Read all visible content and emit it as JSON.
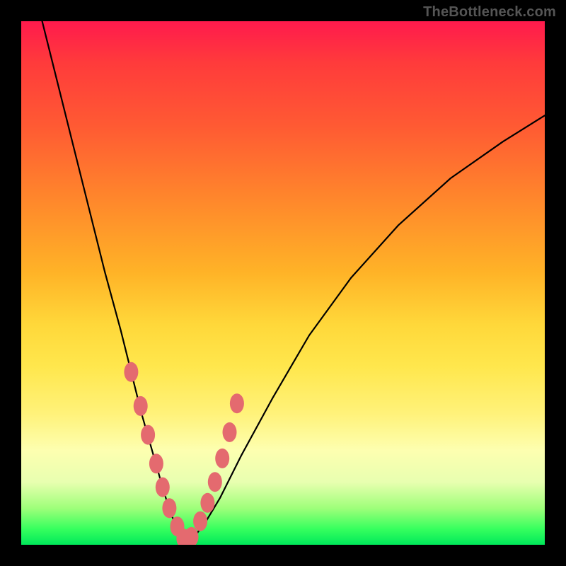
{
  "watermark": "TheBottleneck.com",
  "chart_data": {
    "type": "line",
    "title": "",
    "xlabel": "",
    "ylabel": "",
    "xlim": [
      0,
      100
    ],
    "ylim": [
      0,
      100
    ],
    "series": [
      {
        "name": "bottleneck-curve",
        "x": [
          4,
          7,
          10,
          13,
          16,
          19,
          21,
          23,
          25,
          27,
          28.5,
          30,
          31.5,
          33,
          35,
          38,
          42,
          48,
          55,
          63,
          72,
          82,
          92,
          100
        ],
        "y": [
          100,
          88,
          76,
          64,
          52,
          41,
          33,
          25,
          18,
          11,
          6,
          3,
          1,
          1.5,
          4,
          9,
          17,
          28,
          40,
          51,
          61,
          70,
          77,
          82
        ]
      }
    ],
    "markers": {
      "name": "highlight-dots",
      "x": [
        21.0,
        22.8,
        24.2,
        25.8,
        27.0,
        28.3,
        29.8,
        31.0,
        32.5,
        34.2,
        35.6,
        37.0,
        38.4,
        39.8,
        41.2
      ],
      "y": [
        33.0,
        26.5,
        21.0,
        15.5,
        11.0,
        7.0,
        3.5,
        1.2,
        1.5,
        4.5,
        8.0,
        12.0,
        16.5,
        21.5,
        27.0
      ]
    },
    "colors": {
      "curve": "#000000",
      "marker": "#e46a6f"
    }
  }
}
